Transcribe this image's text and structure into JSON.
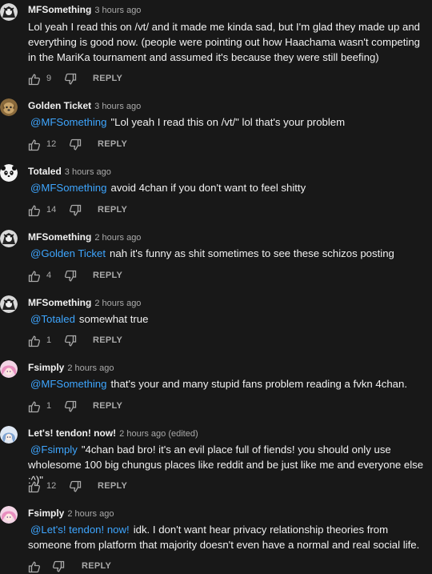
{
  "colors": {
    "background": "#181818",
    "mention": "#3ea6ff",
    "secondary_text": "#aaaaaa"
  },
  "comments": [
    {
      "author": "MFSomething",
      "time": "3 hours ago",
      "mention": "",
      "text": "Lol yeah I read this on /vt/ and it made me kinda sad, but I'm glad they made up and everything is good now. (people were pointing out how Haachama wasn't competing in the MariKa tournament and assumed it's because they were still beefing)",
      "likes": "9",
      "reply": "REPLY",
      "avatar_icon": "bw-anime-avatar"
    },
    {
      "author": "Golden Ticket",
      "time": "3 hours ago",
      "mention": "@MFSomething",
      "text": "\"Lol yeah I read this on /vt/\" lol that's your problem",
      "likes": "12",
      "reply": "REPLY",
      "avatar_icon": "dog-avatar"
    },
    {
      "author": "Totaled",
      "time": "3 hours ago",
      "mention": "@MFSomething",
      "text": "avoid 4chan if you don't want to feel shitty",
      "likes": "14",
      "reply": "REPLY",
      "avatar_icon": "panda-avatar"
    },
    {
      "author": "MFSomething",
      "time": "2 hours ago",
      "mention": "@Golden Ticket",
      "text": "nah it's funny as shit sometimes to see these schizos posting",
      "likes": "4",
      "reply": "REPLY",
      "avatar_icon": "bw-anime-avatar"
    },
    {
      "author": "MFSomething",
      "time": "2 hours ago",
      "mention": "@Totaled",
      "text": "somewhat true",
      "likes": "1",
      "reply": "REPLY",
      "avatar_icon": "bw-anime-avatar"
    },
    {
      "author": "Fsimply",
      "time": "2 hours ago",
      "mention": "@MFSomething",
      "text": "that's your and many stupid fans problem reading a fvkn 4chan.",
      "likes": "1",
      "reply": "REPLY",
      "avatar_icon": "pink-anime-avatar"
    },
    {
      "author": "Let's! tendon! now!",
      "time": "2 hours ago (edited)",
      "mention": "@Fsimply",
      "text": "\"4chan bad bro! it's an evil place full of fiends! you should only use wholesome 100 big chungus places like reddit and be just like me and everyone else :^)\"",
      "likes": "12",
      "reply": "REPLY",
      "avatar_icon": "blue-anime-avatar"
    },
    {
      "author": "Fsimply",
      "time": "2 hours ago",
      "mention": "@Let's! tendon! now!",
      "text": "idk. I don't want hear privacy relationship theories from someone from platform that majority doesn't even have a normal and real social life.",
      "likes": "",
      "reply": "REPLY",
      "avatar_icon": "pink-anime-avatar"
    }
  ]
}
